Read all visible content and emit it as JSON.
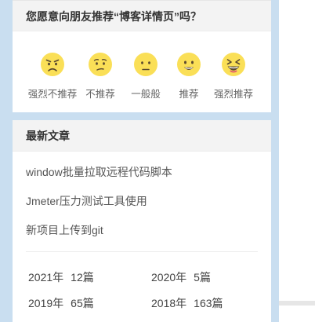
{
  "recommend": {
    "title": "您愿意向朋友推荐“博客详情页”吗？",
    "options": [
      {
        "label": "强烈不推荐",
        "icon": "angry-face-icon"
      },
      {
        "label": "不推荐",
        "icon": "worried-face-icon"
      },
      {
        "label": "一般般",
        "icon": "neutral-face-icon"
      },
      {
        "label": "推荐",
        "icon": "smiling-face-icon"
      },
      {
        "label": "强烈推荐",
        "icon": "grinning-face-icon"
      }
    ],
    "face_color": "#fadf57"
  },
  "articles": {
    "title": "最新文章",
    "items": [
      "window批量拉取远程代码脚本",
      "Jmeter压力测试工具使用",
      "新项目上传到git"
    ]
  },
  "archive": [
    {
      "year": "2021年",
      "count": "12篇"
    },
    {
      "year": "2020年",
      "count": "5篇"
    },
    {
      "year": "2019年",
      "count": "65篇"
    },
    {
      "year": "2018年",
      "count": "163篇"
    }
  ]
}
